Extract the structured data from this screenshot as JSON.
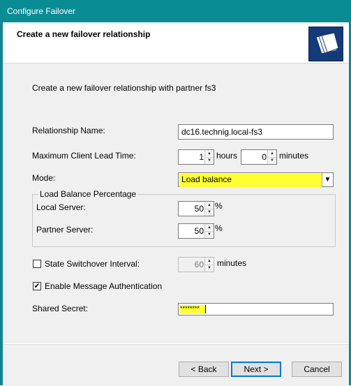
{
  "window": {
    "title": "Configure Failover"
  },
  "header": {
    "title": "Create a new failover relationship"
  },
  "intro": "Create a new failover relationship with partner fs3",
  "relationship": {
    "label": "Relationship Name:",
    "value": "dc16.technig.local-fs3"
  },
  "mclt": {
    "label": "Maximum Client Lead Time:",
    "hours": "1",
    "hours_label": "hours",
    "minutes": "0",
    "minutes_label": "minutes"
  },
  "mode": {
    "label": "Mode:",
    "value": "Load balance"
  },
  "load_balance": {
    "group_label": "Load Balance Percentage",
    "local_label": "Local Server:",
    "local_value": "50",
    "local_unit": "%",
    "partner_label": "Partner Server:",
    "partner_value": "50",
    "partner_unit": "%"
  },
  "state_switchover": {
    "label": "State Switchover Interval:",
    "checked": false,
    "value": "60",
    "unit": "minutes"
  },
  "message_auth": {
    "label": "Enable Message Authentication",
    "checked": true
  },
  "shared_secret": {
    "label": "Shared Secret:",
    "masked": "********"
  },
  "buttons": {
    "back": "< Back",
    "next": "Next >",
    "cancel": "Cancel"
  },
  "colors": {
    "titlebar": "#0a8c94",
    "highlight": "#ffff33",
    "logo": "#143a78"
  },
  "icons": {
    "logo": "folders-icon",
    "dropdown": "chevron-down-icon",
    "spin_up": "arrow-up-icon",
    "spin_down": "arrow-down-icon"
  }
}
